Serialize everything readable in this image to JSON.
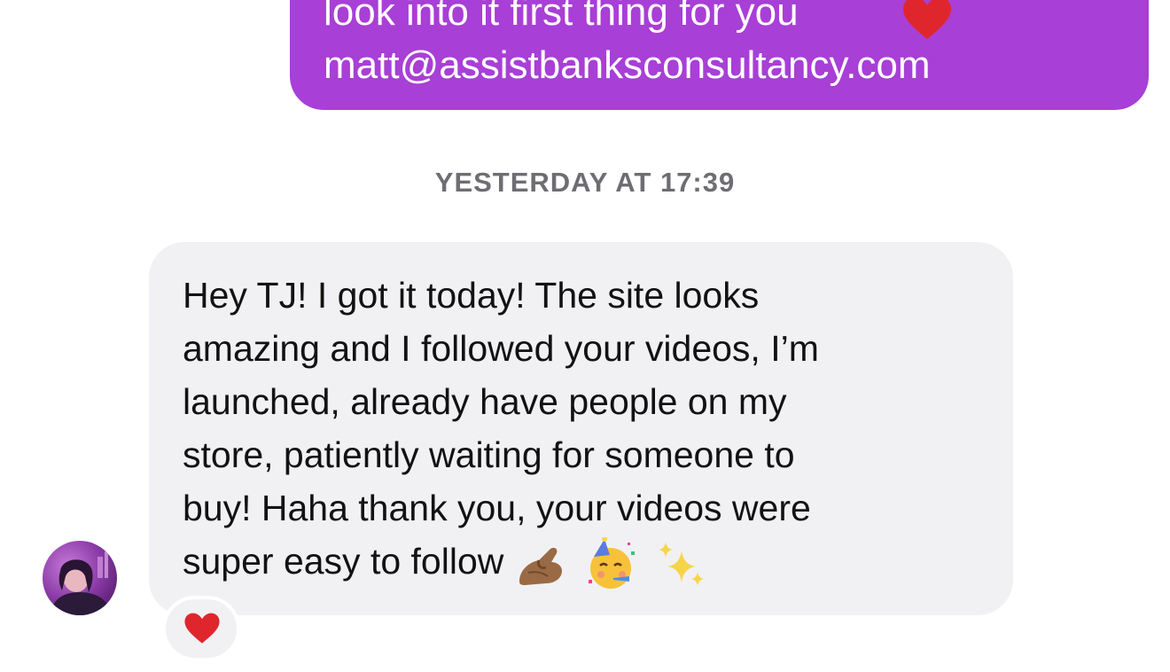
{
  "outgoing_message": {
    "lines": [
      "look into it first thing for you",
      "matt@assistbanksconsultancy.com"
    ],
    "trailing_emoji": "heart-icon"
  },
  "timestamp": "YESTERDAY AT 17:39",
  "incoming_message": {
    "lines": [
      "Hey TJ! I got it today! The site looks",
      "amazing and I followed your videos, I’m",
      "launched, already have people on my",
      "store, patiently waiting for someone to",
      "buy! Haha thank you, your videos were",
      "super easy to follow"
    ],
    "emojis": [
      "pinching-hand-icon",
      "party-face-icon",
      "sparkles-icon"
    ]
  },
  "reaction": {
    "emoji": "heart-icon"
  },
  "colors": {
    "outgoing_bubble": "#a83fd6",
    "incoming_bubble": "#f1f1f4",
    "timestamp_text": "#6d6d73",
    "heart": "#e0262d"
  }
}
